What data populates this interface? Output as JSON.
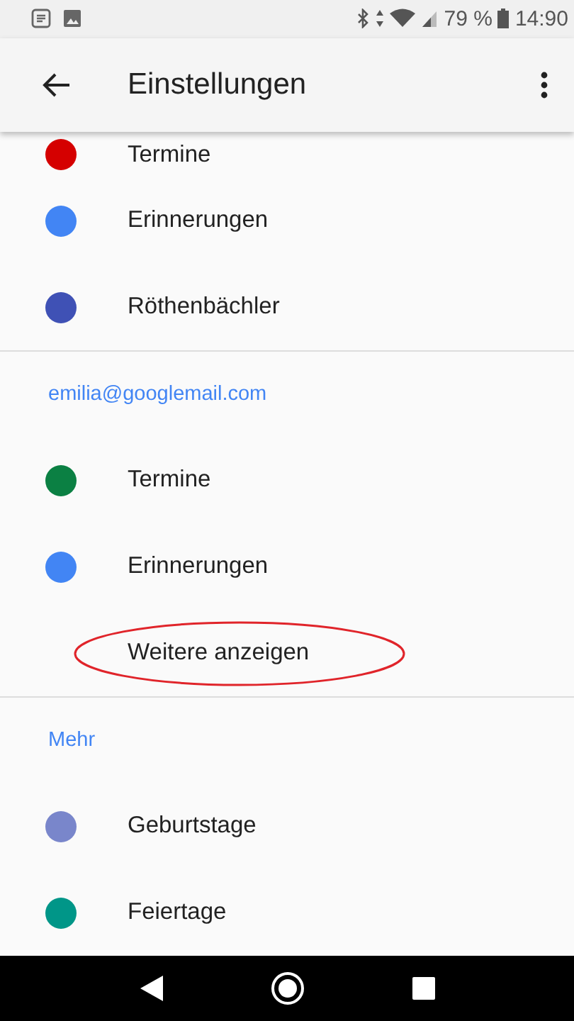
{
  "status_bar": {
    "battery_text": "79 %",
    "time": "14:90"
  },
  "app_bar": {
    "title": "Einstellungen"
  },
  "sections": [
    {
      "items": [
        {
          "label": "Termine",
          "color": "#d50000"
        },
        {
          "label": "Erinnerungen",
          "color": "#4285f4"
        },
        {
          "label": "Röthenbächler",
          "color": "#3f51b5"
        }
      ]
    },
    {
      "header": "emilia@googlemail.com",
      "items": [
        {
          "label": "Termine",
          "color": "#0b8043"
        },
        {
          "label": "Erinnerungen",
          "color": "#4285f4"
        }
      ],
      "show_more": {
        "label": "Weitere anzeigen",
        "circled": true
      }
    },
    {
      "header": "Mehr",
      "items": [
        {
          "label": "Geburtstage",
          "color": "#7986cb"
        },
        {
          "label": "Feiertage",
          "color": "#009688"
        }
      ]
    }
  ]
}
